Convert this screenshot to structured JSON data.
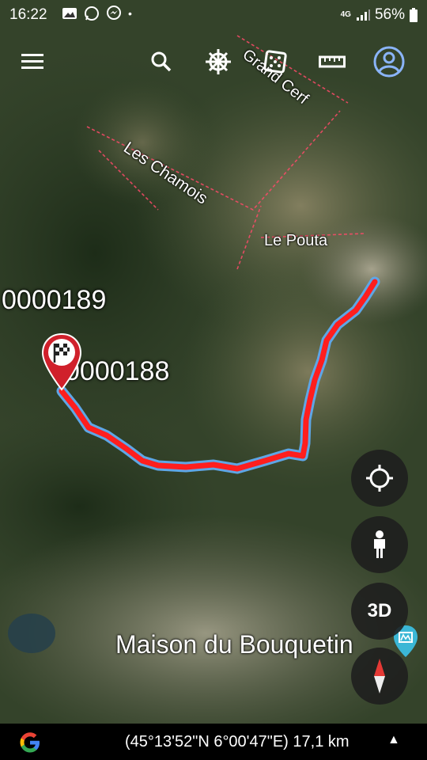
{
  "status": {
    "time": "16:22",
    "network": "4G",
    "battery": "56%"
  },
  "toolbar": {
    "icons": [
      "menu-icon",
      "search-icon",
      "helm-icon",
      "dice-icon",
      "ruler-icon",
      "account-icon"
    ]
  },
  "map": {
    "labels": {
      "grand_cerf": "Grand Cerf",
      "les_chamois": "Les Chamois",
      "le_pouta": "Le Pouta",
      "maison": "Maison du Bouquetin"
    },
    "waypoints": {
      "wp1": "0000189",
      "wp2": "0000188"
    },
    "track_color": "#ff1e1e",
    "track_outline_color": "#5ea6e6"
  },
  "fabs": {
    "three_d": "3D"
  },
  "bottom": {
    "coords": "(45°13'52\"N 6°00'47\"E) 17,1 km"
  }
}
